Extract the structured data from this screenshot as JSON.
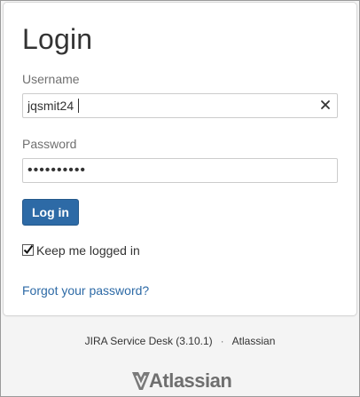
{
  "login": {
    "title": "Login",
    "username_label": "Username",
    "username_value": "jqsmit24",
    "password_label": "Password",
    "password_value": "••••••••••",
    "login_button": "Log in",
    "keep_logged_in_label": "Keep me logged in",
    "keep_logged_in_checked": true,
    "forgot_link": "Forgot your password?"
  },
  "footer": {
    "product": "JIRA Service Desk (3.10.1)",
    "separator": "·",
    "vendor_link": "Atlassian"
  },
  "logo": {
    "text": "Atlassian",
    "icon": "atlassian-logo-icon"
  },
  "colors": {
    "primary": "#2d6aa6",
    "link": "#2d6aa6",
    "background": "#f4f4f4",
    "card": "#ffffff"
  },
  "icons": {
    "clear": "close-icon",
    "check": "checkmark-icon"
  }
}
